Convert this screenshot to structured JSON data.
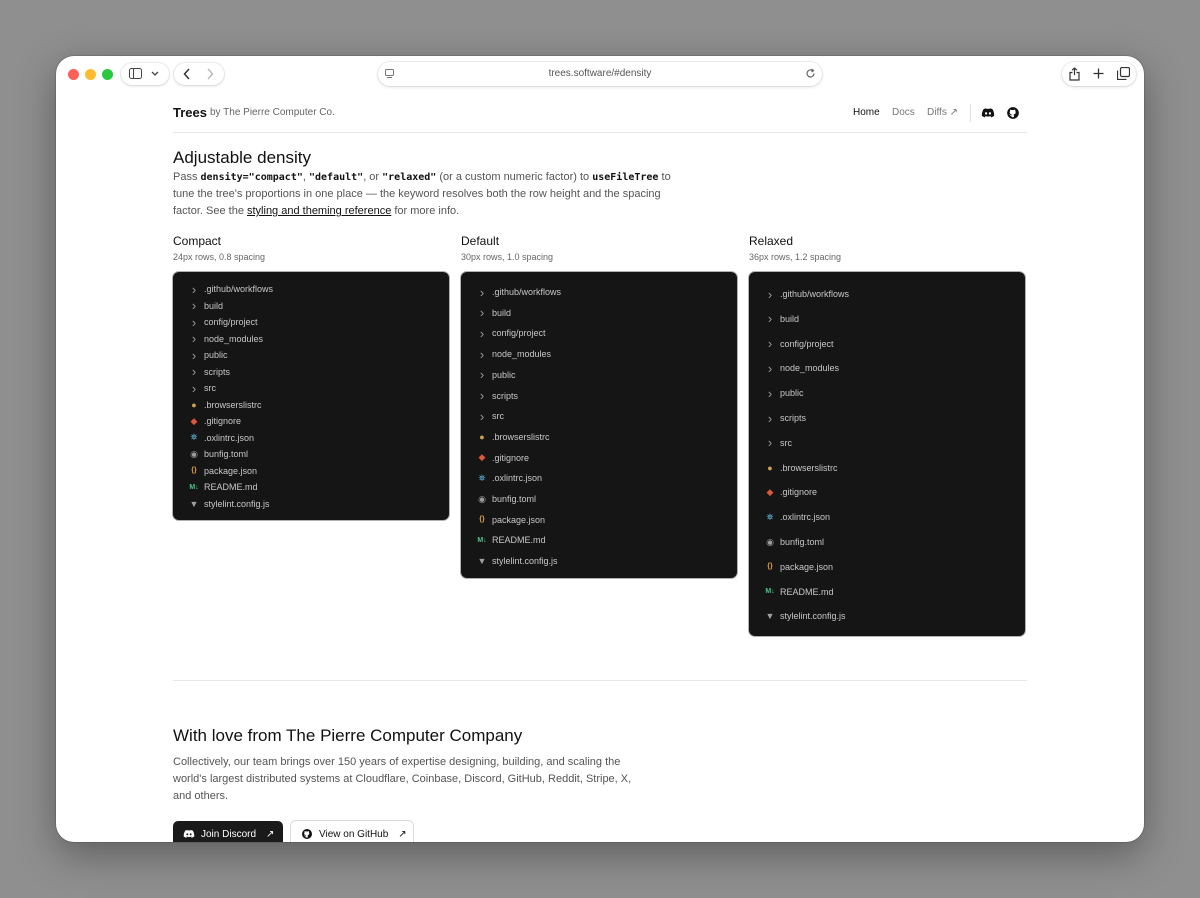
{
  "browser": {
    "url": "trees.software/#density"
  },
  "header": {
    "brand": "Trees",
    "brand_by": "by The Pierre Computer Co.",
    "nav": {
      "home": "Home",
      "docs": "Docs",
      "diffs": "Diffs ↗"
    }
  },
  "density": {
    "title": "Adjustable density",
    "desc_pass": "Pass ",
    "code_compact": "density=\"compact\"",
    "comma1": ", ",
    "code_default": "\"default\"",
    "or": ", or ",
    "code_relaxed": "\"relaxed\"",
    "custom": " (or a custom numeric factor) to ",
    "code_hook": "useFileTree",
    "rest": " to tune the tree's proportions in one place — the keyword resolves both the row height and the spacing factor. See the ",
    "link": "styling and theming reference",
    "tail": " for more info."
  },
  "columns": [
    {
      "title": "Compact",
      "subtitle": "24px rows, 0.8 spacing"
    },
    {
      "title": "Default",
      "subtitle": "30px rows, 1.0 spacing"
    },
    {
      "title": "Relaxed",
      "subtitle": "36px rows, 1.2 spacing"
    }
  ],
  "tree_items": [
    {
      "label": ".github/workflows",
      "icon": "chevron-right-icon",
      "color": "#9a9a9a"
    },
    {
      "label": "build",
      "icon": "chevron-right-icon",
      "color": "#9a9a9a"
    },
    {
      "label": "config/project",
      "icon": "chevron-right-icon",
      "color": "#9a9a9a"
    },
    {
      "label": "node_modules",
      "icon": "chevron-right-icon",
      "color": "#9a9a9a"
    },
    {
      "label": "public",
      "icon": "chevron-right-icon",
      "color": "#9a9a9a"
    },
    {
      "label": "scripts",
      "icon": "chevron-right-icon",
      "color": "#9a9a9a"
    },
    {
      "label": "src",
      "icon": "chevron-right-icon",
      "color": "#9a9a9a"
    },
    {
      "label": ".browserslistrc",
      "icon": "browserslist-icon",
      "color": "#c8a24a"
    },
    {
      "label": ".gitignore",
      "icon": "git-icon",
      "color": "#e0583a"
    },
    {
      "label": ".oxlintrc.json",
      "icon": "oxlint-icon",
      "color": "#5fb6e0"
    },
    {
      "label": "bunfig.toml",
      "icon": "bun-icon",
      "color": "#9a9a9a"
    },
    {
      "label": "package.json",
      "icon": "json-braces-icon",
      "color": "#e0a03a"
    },
    {
      "label": "README.md",
      "icon": "markdown-icon",
      "color": "#4cc38a"
    },
    {
      "label": "stylelint.config.js",
      "icon": "stylelint-icon",
      "color": "#a0a0a0"
    }
  ],
  "footer": {
    "title": "With love from The Pierre Computer Company",
    "text": "Collectively, our team brings over 150 years of expertise designing, building, and scaling the world's largest distributed systems at Cloudflare, Coinbase, Discord, GitHub, Reddit, Stripe, X, and others.",
    "discord_label": "Join Discord",
    "github_label": "View on GitHub",
    "arrow": "↗"
  }
}
